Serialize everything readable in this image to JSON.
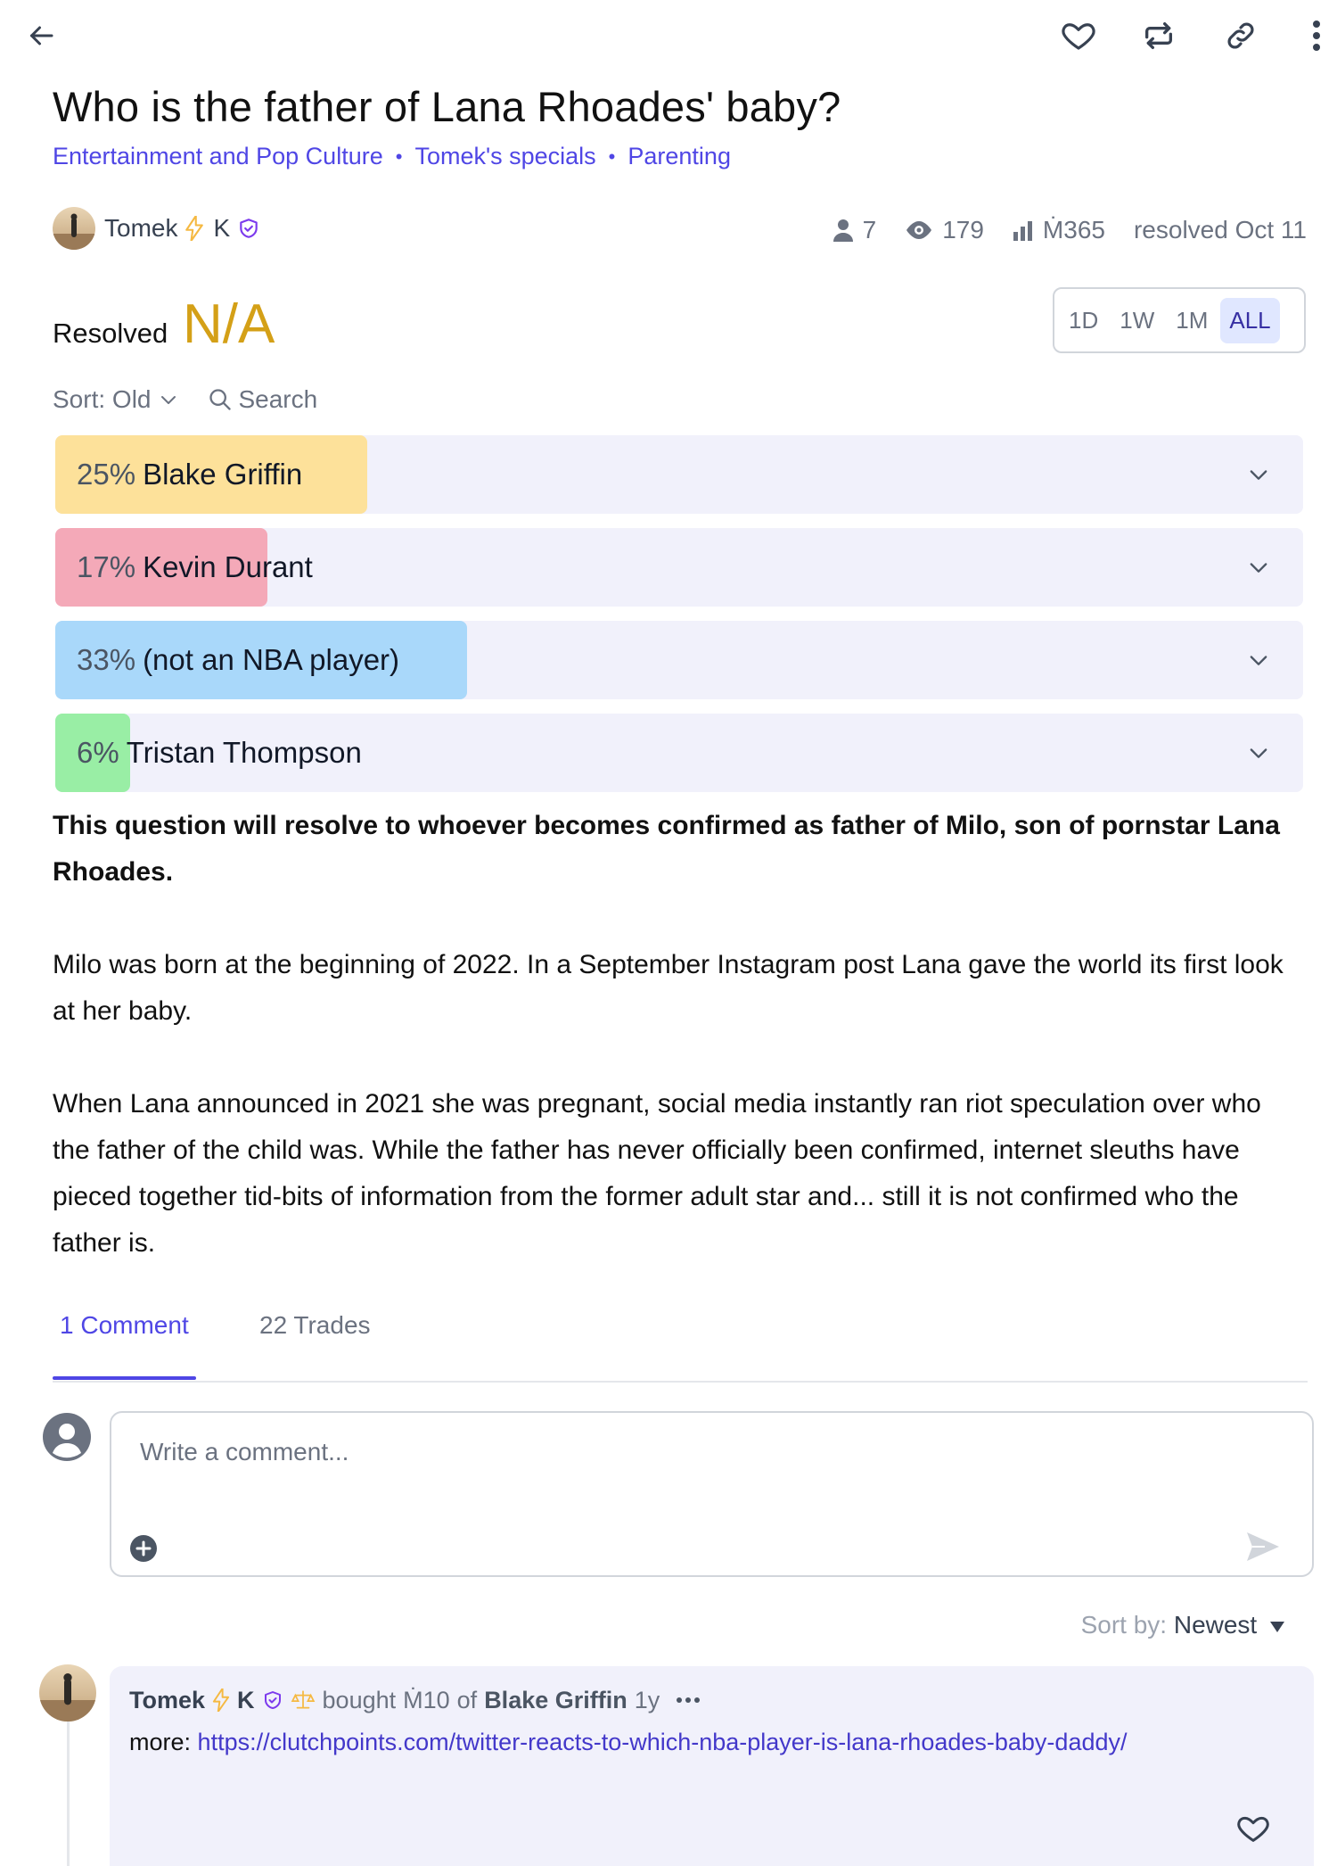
{
  "header": {
    "back_icon": "arrow-left-icon",
    "actions": [
      "heart-icon",
      "repost-icon",
      "link-icon",
      "more-vertical-icon"
    ]
  },
  "market": {
    "title": "Who is the father of Lana Rhoades' baby?",
    "categories": [
      "Entertainment and Pop Culture",
      "Tomek's specials",
      "Parenting"
    ],
    "creator": {
      "name": "Tomek",
      "badge": "K"
    },
    "stats": {
      "traders": "7",
      "views": "179",
      "volume": "Ṁ365",
      "resolved": "resolved Oct 11"
    },
    "resolution_label": "Resolved",
    "resolution_value": "N/A"
  },
  "time_range": {
    "options": [
      "1D",
      "1W",
      "1M",
      "ALL"
    ],
    "selected": "ALL"
  },
  "sort": {
    "label": "Sort: Old",
    "search_label": "Search"
  },
  "answers": [
    {
      "pct": "25%",
      "name": "Blake Griffin",
      "prob": 0.25,
      "color": "#fde19a"
    },
    {
      "pct": "17%",
      "name": "Kevin Durant",
      "prob": 0.17,
      "color": "#f4a9b8"
    },
    {
      "pct": "33%",
      "name": "(not an NBA player)",
      "prob": 0.33,
      "color": "#a9d8fa"
    },
    {
      "pct": "6%",
      "name": "Tristan Thompson",
      "prob": 0.06,
      "color": "#99eea5"
    }
  ],
  "description": {
    "p1": "This question will resolve to whoever becomes confirmed as father of Milo, son of pornstar Lana Rhoades.",
    "p2": "Milo was born at the beginning of 2022. In a September Instagram post Lana gave the world its first look at her baby.",
    "p3": "When Lana announced in 2021 she was pregnant, social media instantly ran riot speculation over who the father of the child was. While the father has never officially been confirmed, internet sleuths have pieced together tid-bits of information from the former adult star and... still it is not confirmed who the father is."
  },
  "tabs": {
    "comments": "1 Comment",
    "trades": "22 Trades"
  },
  "comment_input": {
    "placeholder": "Write a comment..."
  },
  "comment_sort": {
    "label": "Sort by:",
    "value": "Newest"
  },
  "comments": [
    {
      "author": "Tomek",
      "badge": "K",
      "bought": "bought",
      "amount": "Ṁ10",
      "of": "of",
      "answer": "Blake Griffin",
      "time": "1y",
      "more": "more:",
      "link": "https://clutchpoints.com/twitter-reacts-to-which-nba-player-is-lana-rhoades-baby-daddy/"
    }
  ],
  "colors": {
    "accent": "#4f46e5",
    "resolved": "#d4a017",
    "answer_bg": "#f1f1fb"
  }
}
